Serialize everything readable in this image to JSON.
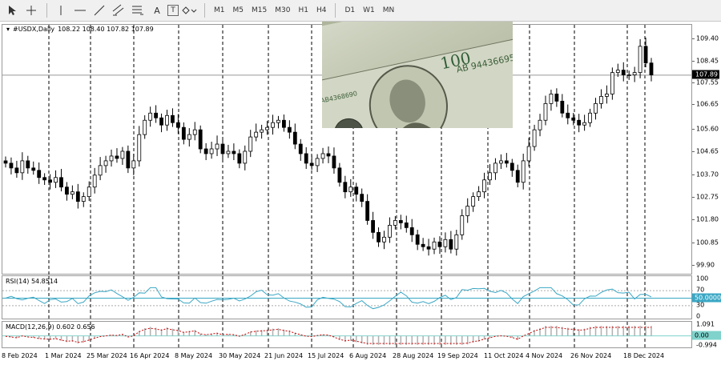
{
  "toolbar": {
    "tools": [
      "cursor-icon",
      "crosshair-icon",
      "vertical-line-icon",
      "horizontal-line-icon",
      "trendline-icon",
      "channel-icon",
      "fibonacci-icon",
      "text-icon",
      "label-icon",
      "shapes-icon"
    ],
    "text_tool": "A",
    "label_tool": "T",
    "timeframes": [
      "M1",
      "M5",
      "M15",
      "M30",
      "H1",
      "H4",
      "D1",
      "W1",
      "MN"
    ]
  },
  "main": {
    "symbol": "#USDX,Daily",
    "ohlc": "108.22 108.40 107.82 107.89",
    "current_price": "107.89",
    "y_ticks": [
      "109.40",
      "108.45",
      "107.55",
      "106.65",
      "105.60",
      "104.65",
      "103.70",
      "102.75",
      "101.80",
      "100.85",
      "99.90"
    ],
    "y_range": [
      99.5,
      110.0
    ],
    "accent_up": "#000000",
    "grid_color": "#000000"
  },
  "rsi": {
    "label": "RSI(14) 54.8514",
    "levels": [
      "100",
      "70",
      "30",
      "0"
    ],
    "current": "50.0000",
    "line_color": "#3aa7c4"
  },
  "macd": {
    "label": "MACD(12,26,9) 0.602 0.656",
    "levels": [
      "1.091",
      "0.00",
      "-0.994"
    ],
    "current": "0.00",
    "signal_color": "#cc0000"
  },
  "x_ticks": [
    "8 Feb 2024",
    "1 Mar 2024",
    "25 Mar 2024",
    "16 Apr 2024",
    "8 May 2024",
    "30 May 2024",
    "21 Jun 2024",
    "15 Jul 2024",
    "6 Aug 2024",
    "28 Aug 2024",
    "19 Sep 2024",
    "11 Oct 2024",
    "4 Nov 2024",
    "26 Nov 2024",
    "18 Dec 2024"
  ],
  "chart_data": {
    "type": "candlestick",
    "symbol": "#USDX,Daily",
    "x_labels": [
      "8 Feb 2024",
      "1 Mar 2024",
      "25 Mar 2024",
      "16 Apr 2024",
      "8 May 2024",
      "30 May 2024",
      "21 Jun 2024",
      "15 Jul 2024",
      "6 Aug 2024",
      "28 Aug 2024",
      "19 Sep 2024",
      "11 Oct 2024",
      "4 Nov 2024",
      "26 Nov 2024",
      "18 Dec 2024"
    ],
    "close_path": [
      104.2,
      104.0,
      103.8,
      104.3,
      104.0,
      103.9,
      103.6,
      103.5,
      103.4,
      103.6,
      103.2,
      102.9,
      103.0,
      102.6,
      102.8,
      103.2,
      103.7,
      104.1,
      104.3,
      104.5,
      104.4,
      104.7,
      104.0,
      104.3,
      105.4,
      106.0,
      106.3,
      106.1,
      105.8,
      106.2,
      105.9,
      105.7,
      105.2,
      105.4,
      105.6,
      104.8,
      104.6,
      104.8,
      105.0,
      104.6,
      104.7,
      104.6,
      104.2,
      104.7,
      105.3,
      105.5,
      105.6,
      105.7,
      105.9,
      106.0,
      105.7,
      105.5,
      105.0,
      104.6,
      104.2,
      104.1,
      104.4,
      104.6,
      104.5,
      104.0,
      103.4,
      103.0,
      103.2,
      102.9,
      102.6,
      101.8,
      101.3,
      100.9,
      101.1,
      101.6,
      101.8,
      101.7,
      101.5,
      101.2,
      100.8,
      100.7,
      100.6,
      100.9,
      100.7,
      101.0,
      100.6,
      101.2,
      102.0,
      102.4,
      102.8,
      103.0,
      103.5,
      103.8,
      104.2,
      104.3,
      104.2,
      103.9,
      103.4,
      104.3,
      104.9,
      105.6,
      106.0,
      106.7,
      107.1,
      106.8,
      106.3,
      106.1,
      106.0,
      105.8,
      105.9,
      106.3,
      106.7,
      107.0,
      107.1,
      108.0,
      108.1,
      107.9,
      107.9,
      108.0,
      109.1,
      108.4,
      107.9
    ],
    "y_ticks": [
      109.4,
      108.45,
      107.55,
      106.65,
      105.6,
      104.65,
      103.7,
      102.75,
      101.8,
      100.85,
      99.9
    ],
    "current_price": 107.89,
    "rsi": {
      "period": 14,
      "value": 54.8514,
      "levels": [
        100,
        70,
        30,
        0
      ]
    },
    "macd": {
      "fast": 12,
      "slow": 26,
      "signal": 9,
      "main": 0.602,
      "signal_value": 0.656,
      "range": [
        -0.994,
        1.091
      ]
    }
  }
}
